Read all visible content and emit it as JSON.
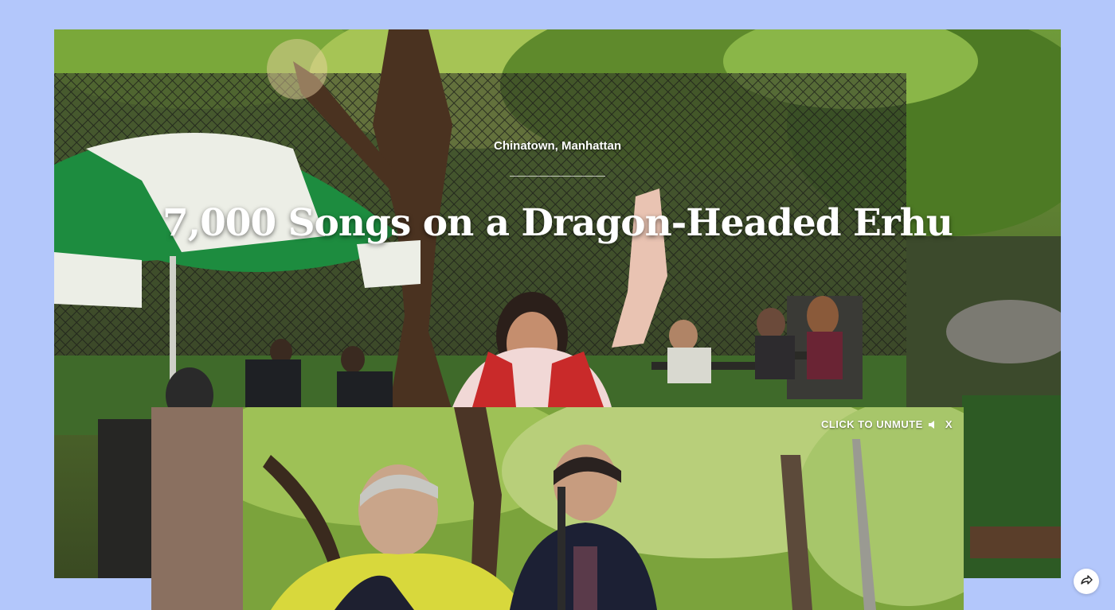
{
  "page": {
    "background_color": "#b3c7fb"
  },
  "hero": {
    "kicker": "Chinatown, Manhattan",
    "headline": "7,000 Songs on a Dragon-Headed Erhu",
    "image_description_icon": "park-performer-photo"
  },
  "video": {
    "unmute_label": "CLICK TO UNMUTE",
    "close_label": "X",
    "speaker_icon": "speaker-muted-icon"
  },
  "share": {
    "icon": "share-arrow-icon"
  }
}
